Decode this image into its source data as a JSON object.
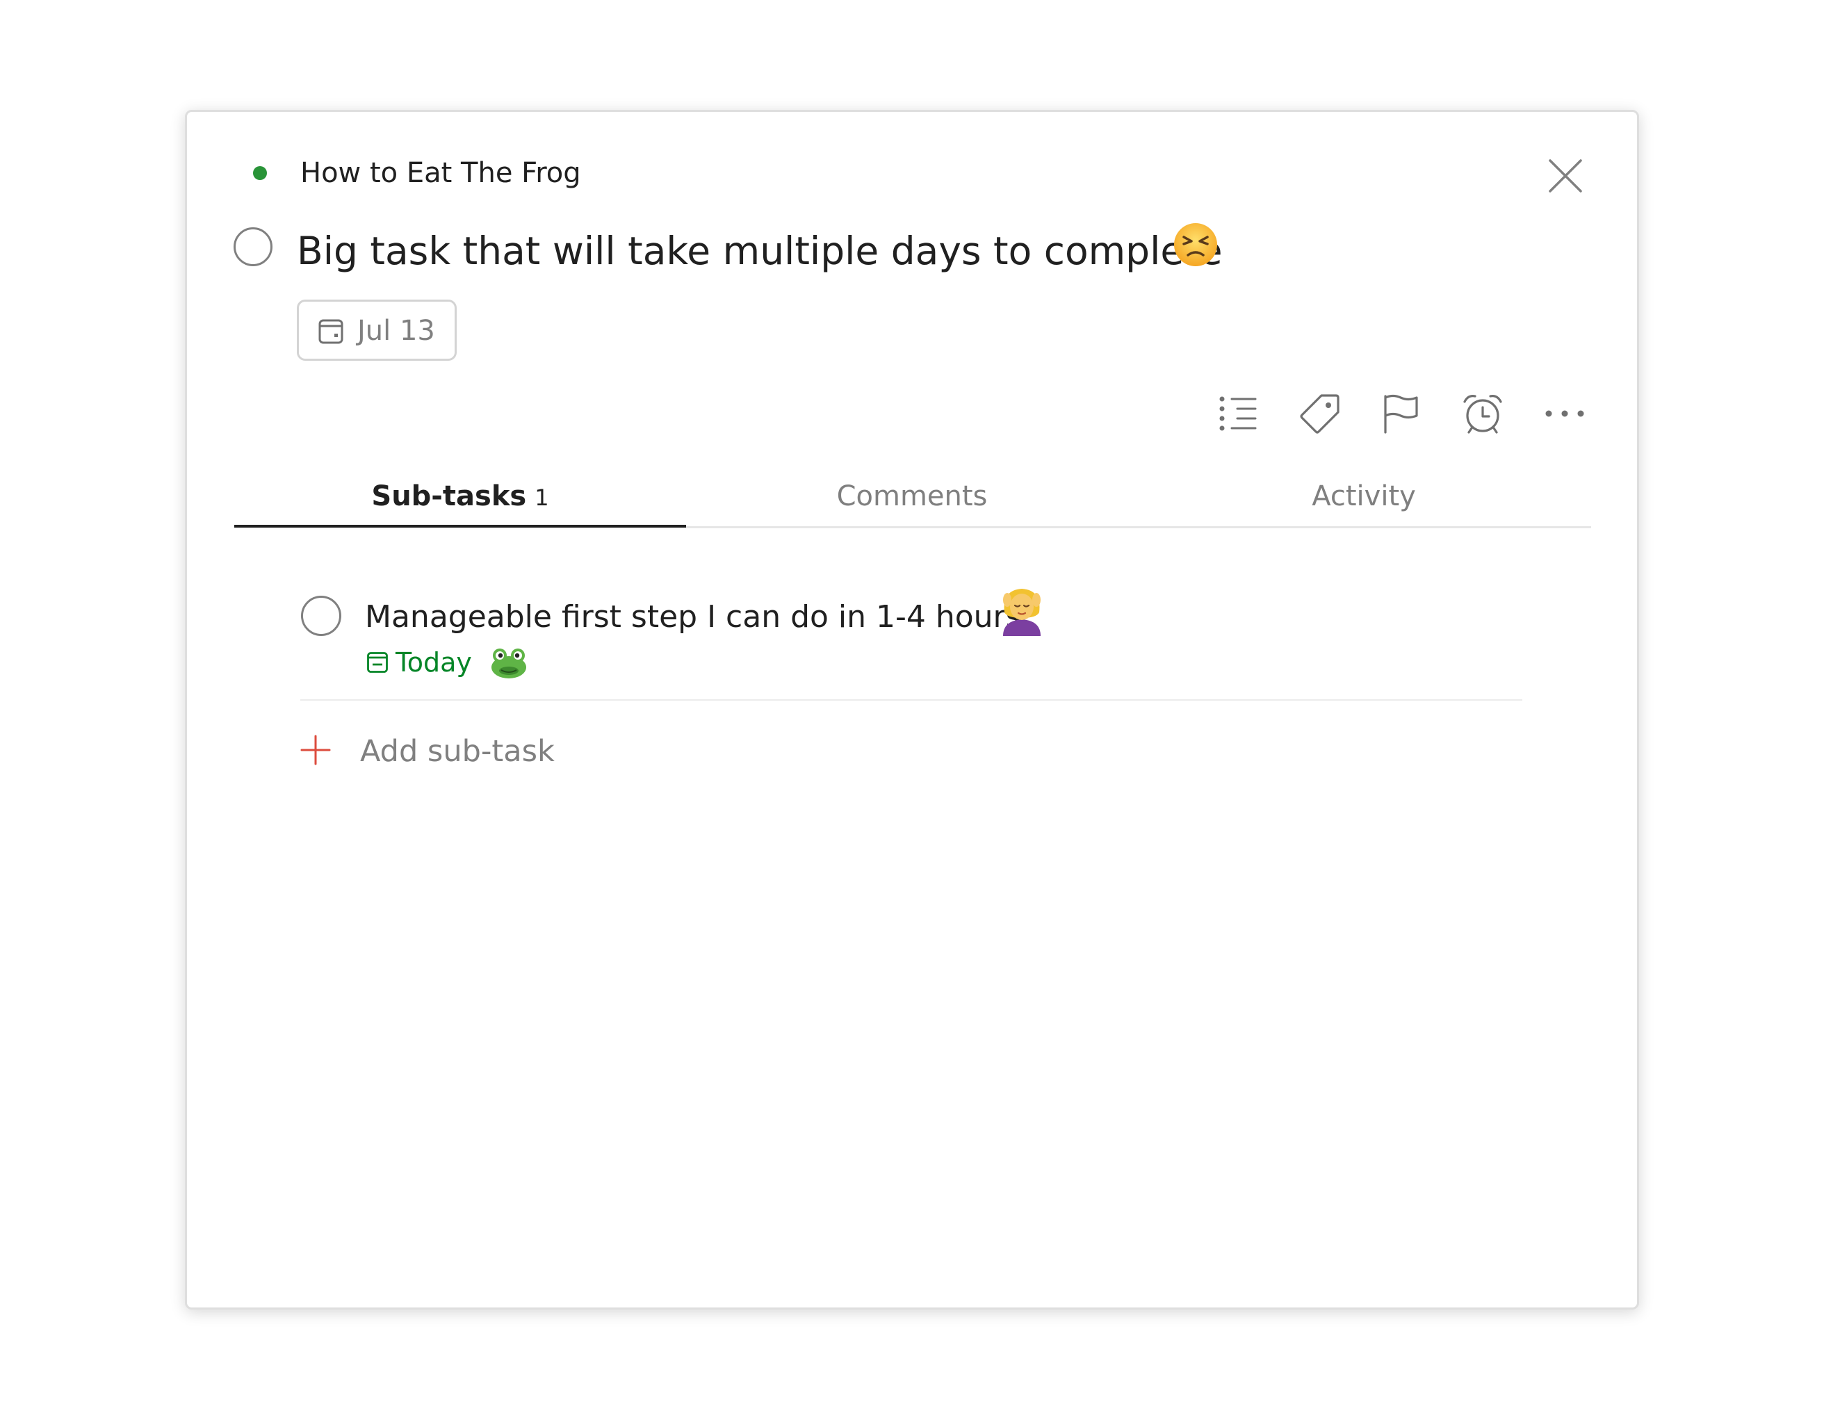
{
  "colors": {
    "project_dot": "#299438",
    "today_green": "#058527",
    "add_red": "#dc4c3e",
    "text_primary": "#202020",
    "text_muted": "#808080"
  },
  "project": {
    "name": "How to Eat The Frog"
  },
  "task": {
    "title": "Big task that will take multiple days to complete",
    "title_emoji": "persevering-face",
    "due_date": "Jul 13"
  },
  "actions": [
    "subtasks-list-icon",
    "label-tag-icon",
    "priority-flag-icon",
    "reminder-alarm-icon",
    "more-options-icon"
  ],
  "tabs": [
    {
      "label": "Sub-tasks",
      "count": "1",
      "active": true
    },
    {
      "label": "Comments",
      "active": false
    },
    {
      "label": "Activity",
      "active": false
    }
  ],
  "subtasks": [
    {
      "title": "Manageable first step I can do in 1-4 hours",
      "title_emoji": "woman-getting-massage",
      "due": "Today",
      "extra_emoji": "frog-face"
    }
  ],
  "add_subtask": {
    "label": "Add sub-task"
  }
}
